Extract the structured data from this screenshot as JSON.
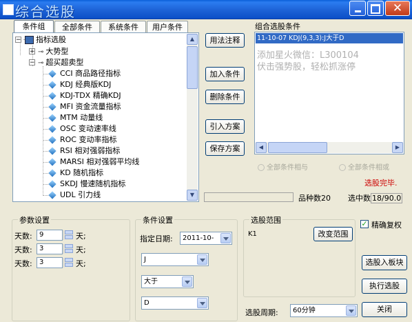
{
  "window": {
    "title": "综合选股"
  },
  "tabs": [
    "条件组",
    "全部条件",
    "系统条件",
    "用户条件"
  ],
  "tree": {
    "root": "指标选股",
    "categories": [
      "大势型",
      "超买超卖型"
    ],
    "items": [
      "CCI 商品路径指标",
      "KDJ 经典版KDJ",
      "KDJ-TDX 精确KDJ",
      "MFI 资金流量指标",
      "MTM 动量线",
      "OSC 变动速率线",
      "ROC 变动率指标",
      "RSI 相对强弱指标",
      "MARSI 相对强弱平均线",
      "KD 随机指标",
      "SKDJ 慢速随机指标",
      "UDL 引力线"
    ]
  },
  "buttons": {
    "usage": "用法注释",
    "add": "加入条件",
    "delete": "删除条件",
    "import": "引入方案",
    "save": "保存方案",
    "change_range": "改变范围",
    "add_to_board": "选股入板块",
    "execute": "执行选股",
    "close": "关闭"
  },
  "combo": {
    "title": "组合选股条件",
    "selected": "11-10-07 KDJ(9,3,3):J大于D",
    "watermark_line1": "添加星火微信：L300104",
    "watermark_line2": "伏击强势股，轻松抓涨停"
  },
  "logic": {
    "and": "全部条件相与",
    "or": "全部条件相或"
  },
  "status": {
    "done": "选股完毕.",
    "variety_label": "品种数",
    "variety_value": "20",
    "selected_label": "选中数",
    "selected_value": "18/90.0"
  },
  "params": {
    "title": "参数设置",
    "rows": [
      {
        "label": "天数:",
        "value": "9",
        "unit": "天;"
      },
      {
        "label": "天数:",
        "value": "3",
        "unit": "天;"
      },
      {
        "label": "天数:",
        "value": "3",
        "unit": "天;"
      }
    ]
  },
  "condition": {
    "title": "条件设置",
    "date_label": "指定日期:",
    "date_value": "2011-10-",
    "line": "J",
    "operator": "大于",
    "target": "D"
  },
  "range": {
    "title": "选股范围",
    "value": "K1",
    "period_label": "选股周期:",
    "period_value": "60分钟"
  },
  "precise": {
    "label": "精确复权",
    "checked": true
  },
  "colors": {
    "accent": "#316ac5",
    "done_red": "#cc0000",
    "titlebar": "#1d62d6"
  }
}
